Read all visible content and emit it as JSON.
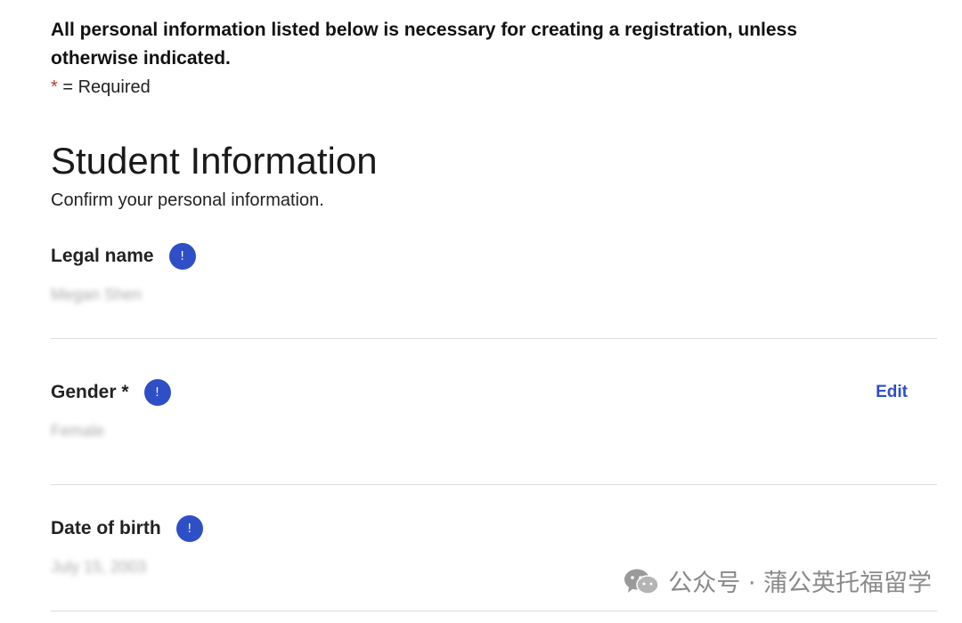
{
  "notice": "All personal information listed below is necessary for creating a registration, unless otherwise indicated.",
  "required_key": {
    "star": "*",
    "text": " = Required"
  },
  "section": {
    "title": "Student Information",
    "subtitle": "Confirm your personal information."
  },
  "fields": [
    {
      "label": "Legal name",
      "info_icon": "!",
      "value": "Megan Shen",
      "edit": ""
    },
    {
      "label": "Gender *",
      "info_icon": "!",
      "value": "Female",
      "edit": "Edit"
    },
    {
      "label": "Date of birth",
      "info_icon": "!",
      "value": "July 15, 2003",
      "edit": ""
    }
  ],
  "watermark": {
    "text": "公众号 · 蒲公英托福留学"
  },
  "colors": {
    "accent": "#2f4fc7",
    "required": "#c0392b",
    "divider": "#dcdcdc"
  }
}
